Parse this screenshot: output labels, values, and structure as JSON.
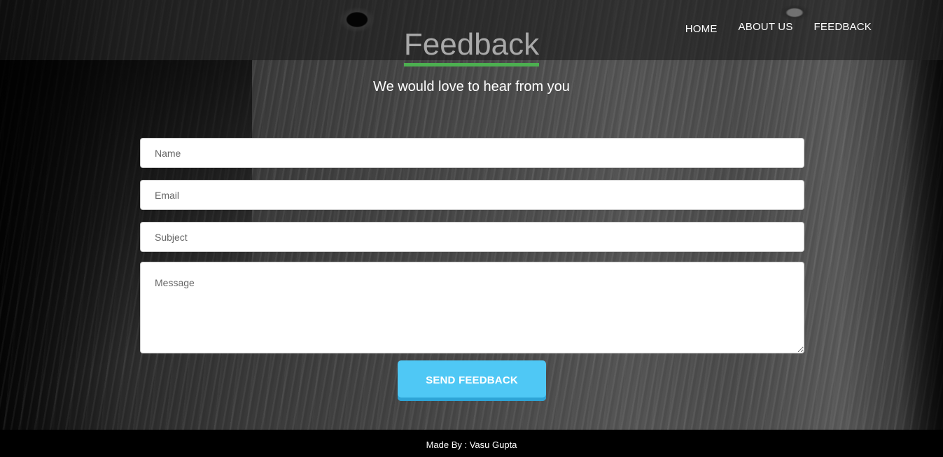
{
  "nav": {
    "items": [
      {
        "label": "HOME"
      },
      {
        "label": "ABOUT US"
      },
      {
        "label": "FEEDBACK"
      }
    ]
  },
  "header": {
    "title": "Feedback",
    "subtitle": "We would love to hear from you"
  },
  "form": {
    "name_placeholder": "Name",
    "email_placeholder": "Email",
    "subject_placeholder": "Subject",
    "message_placeholder": "Message",
    "submit_label": "SEND FEEDBACK"
  },
  "footer": {
    "credit": "Made By : Vasu Gupta"
  },
  "colors": {
    "accent_underline": "#4caf50",
    "button": "#4fc8f5",
    "footer_bg": "#000000"
  }
}
